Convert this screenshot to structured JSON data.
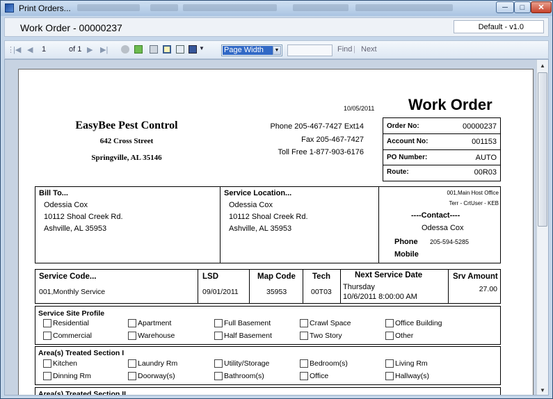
{
  "window": {
    "title": "Print Orders..."
  },
  "header": {
    "title": "Work Order - 00000237",
    "version": "Default - v1.0"
  },
  "toolbar": {
    "page": "1",
    "of": "of 1",
    "zoom": "Page Width",
    "find": "Find",
    "next": "Next"
  },
  "report": {
    "date": "10/05/2011",
    "title": "Work Order",
    "company": {
      "name": "EasyBee Pest Control",
      "street": "642 Cross Street",
      "city": "Springville, AL 35146"
    },
    "phone": "Phone 205-467-7427 Ext14",
    "fax": "Fax 205-467-7427",
    "tollfree": "Toll Free 1-877-903-6176",
    "order": [
      {
        "label": "Order No:",
        "value": "00000237"
      },
      {
        "label": "Account No:",
        "value": "001153"
      },
      {
        "label": "PO Number:",
        "value": "AUTO"
      },
      {
        "label": "Route:",
        "value": "00R03"
      }
    ],
    "bill_to": {
      "heading": "Bill To...",
      "name": "Odessia Cox",
      "street": "10112 Shoal Creek Rd.",
      "city": "Ashville, AL 35953"
    },
    "service_location": {
      "heading": "Service Location...",
      "name": "Odessia Cox",
      "street": "10112 Shoal Creek Rd.",
      "city": "Ashville, AL 35953"
    },
    "office": {
      "line1": "001,Main Host Office",
      "line2": "Terr -  CrtUser - KEB",
      "contact_heading": "----Contact----",
      "contact_name": "Odessa Cox",
      "phone_label": "Phone",
      "phone": "205-594-5285",
      "mobile_label": "Mobile"
    },
    "service": {
      "headers": {
        "code": "Service Code...",
        "lsd": "LSD",
        "map": "Map Code",
        "tech": "Tech",
        "next": "Next Service Date",
        "amount": "Srv Amount"
      },
      "code": "001,Monthly Service",
      "lsd": "09/01/2011",
      "map": "35953",
      "tech": "00T03",
      "next_day": "Thursday",
      "next_date": "10/6/2011 8:00:00 AM",
      "amount": "27.00"
    },
    "site_profile": {
      "heading": "Service Site Profile",
      "items": [
        "Residential",
        "Apartment",
        "Full Basement",
        "Crawl Space",
        "Office Building",
        "Commercial",
        "Warehouse",
        "Half Basement",
        "Two Story",
        "Other"
      ]
    },
    "areas1": {
      "heading": "Area(s) Treated Section I",
      "items": [
        "Kitchen",
        "Laundry Rm",
        "Utility/Storage",
        "Bedroom(s)",
        "Living Rm",
        "Dinning Rm",
        "Doorway(s)",
        "Bathroom(s)",
        "Office",
        "Hallway(s)"
      ]
    },
    "areas2": {
      "heading": "Area(s) Treated Section II"
    }
  }
}
